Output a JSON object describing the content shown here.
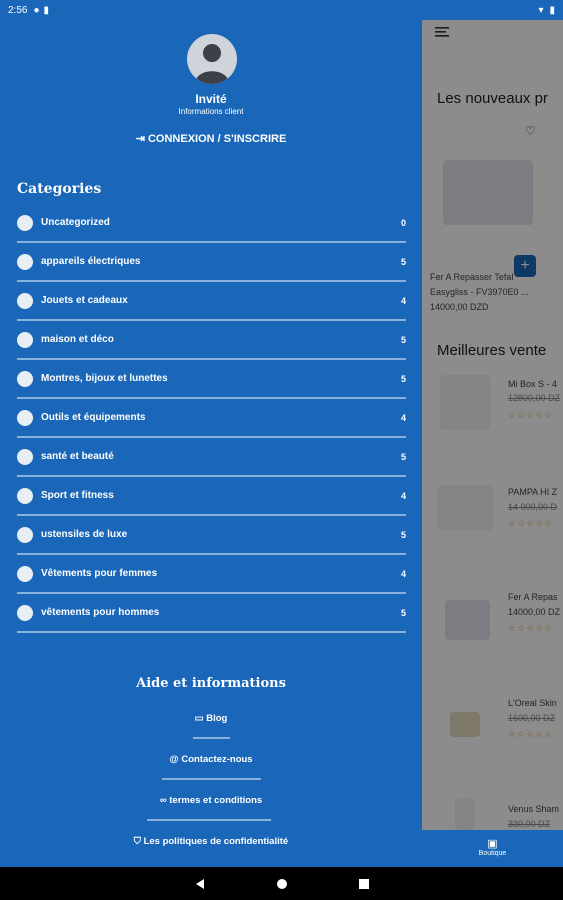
{
  "status": {
    "time": "2:56"
  },
  "app": {
    "new_title": "Les nouveaux pr",
    "best_title": "Meilleures vente",
    "new_card": {
      "name1": "Fer A Repasser Tefal",
      "name2": "Easygliss - FV3970E0 ...",
      "price": "14000,00 DZD"
    },
    "best": [
      {
        "name": "Mi Box S - 4",
        "old": "12800,00 DZ"
      },
      {
        "name": "PAMPA HI Z",
        "old": "14 900,00 D"
      },
      {
        "name": "Fer A Repas",
        "price": "14000,00 DZ"
      },
      {
        "name": "L'Oreal Skin",
        "old": "1600,00 DZ"
      },
      {
        "name": "Venus Sham",
        "old": "330,00 DZ"
      }
    ],
    "stars": "☆☆☆☆☆",
    "tab_label": "Boutique"
  },
  "drawer": {
    "user_name": "Invité",
    "user_sub": "Informations client",
    "login_label": "CONNEXION / S'INSCRIRE",
    "categories_title": "Categories",
    "categories": [
      {
        "label": "Uncategorized",
        "count": "0"
      },
      {
        "label": "appareils électriques",
        "count": "5"
      },
      {
        "label": "Jouets et cadeaux",
        "count": "4"
      },
      {
        "label": "maison et déco",
        "count": "5"
      },
      {
        "label": "Montres, bijoux et lunettes",
        "count": "5"
      },
      {
        "label": "Outils et équipements",
        "count": "4"
      },
      {
        "label": "santé et beauté",
        "count": "5"
      },
      {
        "label": "Sport et fitness",
        "count": "4"
      },
      {
        "label": "ustensiles de luxe",
        "count": "5"
      },
      {
        "label": "Vêtements pour femmes",
        "count": "4"
      },
      {
        "label": "vêtements pour hommes",
        "count": "5"
      }
    ],
    "aide_title": "Aide et informations",
    "aide": [
      {
        "label": "Blog"
      },
      {
        "label": "Contactez-nous"
      },
      {
        "label": "termes et conditions"
      },
      {
        "label": "Les politiques de confidentialité"
      }
    ]
  },
  "colors": {
    "primary": "#1a66b8",
    "divider": "#8ab1db"
  }
}
